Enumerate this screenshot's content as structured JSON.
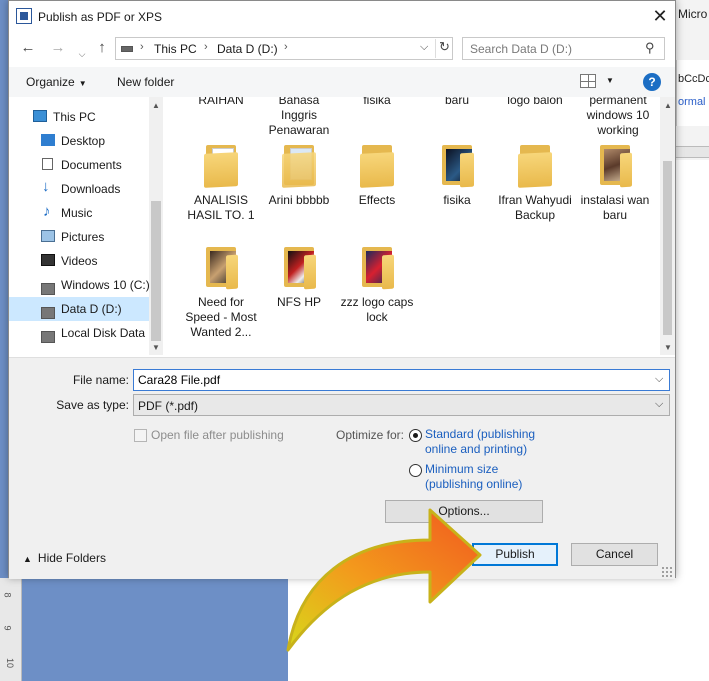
{
  "background_app": {
    "title_fragment": "Micro",
    "style_preview_1": "bCcDc",
    "style_preview_2": "ormal",
    "ruler_marks": [
      "8",
      "9",
      "10"
    ]
  },
  "dialog": {
    "title": "Publish as PDF or XPS",
    "close_glyph": "✕"
  },
  "navigation": {
    "back_glyph": "←",
    "forward_glyph": "→",
    "up_glyph": "↑",
    "breadcrumb": [
      "This PC",
      "Data D (D:)"
    ],
    "breadcrumb_sep": "›",
    "dropdown_glyph": "⌵",
    "refresh_glyph": "↻",
    "search_placeholder": "Search Data D (D:)",
    "search_glyph": "⚲"
  },
  "toolbar": {
    "organize_label": "Organize",
    "new_folder_label": "New folder",
    "help_label": "?"
  },
  "sidebar": {
    "items": [
      {
        "label": "This PC",
        "icon": "computer-icon"
      },
      {
        "label": "Desktop",
        "icon": "desktop-icon"
      },
      {
        "label": "Documents",
        "icon": "documents-icon"
      },
      {
        "label": "Downloads",
        "icon": "downloads-icon"
      },
      {
        "label": "Music",
        "icon": "music-icon"
      },
      {
        "label": "Pictures",
        "icon": "pictures-icon"
      },
      {
        "label": "Videos",
        "icon": "videos-icon"
      },
      {
        "label": "Windows 10 (C:)",
        "icon": "drive-icon"
      },
      {
        "label": "Data D (D:)",
        "icon": "drive-icon",
        "selected": true
      },
      {
        "label": "Local Disk Data (",
        "icon": "drive-icon"
      }
    ]
  },
  "files": [
    {
      "label": "RAIHAN"
    },
    {
      "label": "Bahasa Inggris Penawaran"
    },
    {
      "label": "fisika"
    },
    {
      "label": "baru"
    },
    {
      "label": "logo balon"
    },
    {
      "label": "permanent windows 10 working"
    },
    {
      "label": "ANALISIS HASIL TO. 1"
    },
    {
      "label": "Arini bbbbb"
    },
    {
      "label": "Effects"
    },
    {
      "label": "fisika"
    },
    {
      "label": "Ifran Wahyudi Backup"
    },
    {
      "label": "instalasi wan baru"
    },
    {
      "label": "Need for Speed - Most Wanted 2..."
    },
    {
      "label": "NFS HP"
    },
    {
      "label": "zzz logo caps lock"
    }
  ],
  "form": {
    "file_name_label": "File name:",
    "file_name_value": "Cara28 File.pdf",
    "save_type_label": "Save as type:",
    "save_type_value": "PDF (*.pdf)",
    "open_after_label": "Open file after publishing",
    "optimize_label": "Optimize for:",
    "option_standard": "Standard (publishing online and printing)",
    "option_minimum": "Minimum size (publishing online)",
    "selected_option": "standard",
    "options_button": "Options...",
    "publish_button": "Publish",
    "cancel_button": "Cancel",
    "hide_folders_label": "Hide Folders"
  },
  "colors": {
    "accent": "#0078d7",
    "arrow_orange": "#f26b1d",
    "arrow_yellow": "#d8d81a",
    "selection": "#cce8ff"
  }
}
